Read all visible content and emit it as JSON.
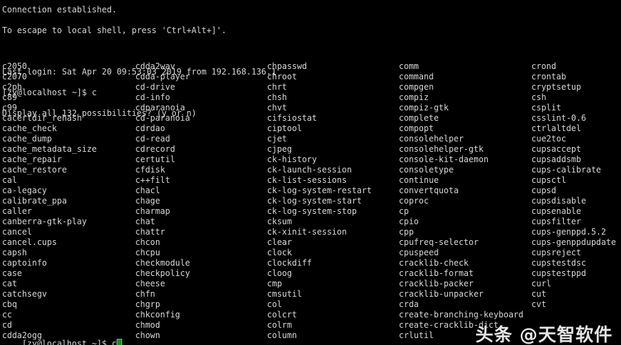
{
  "terminal": {
    "background_color": "#000000",
    "text_color": "#d7d7d7",
    "cursor_color": "#39d353",
    "header_lines": [
      "Connection established.",
      "To escape to local shell, press 'Ctrl+Alt+]'.",
      "",
      "Last login: Sat Apr 20 09:53:03 2019 from 192.168.136.1",
      "[zy@localhost ~]$ c",
      "Display all 132 possibilities? (y or n)"
    ],
    "prompt": {
      "text": "[zy@localhost ~]$ ",
      "typed": "c",
      "cursor": "block-cursor"
    },
    "completion": {
      "count": 132,
      "columns": [
        [
          "c2050",
          "c2070",
          "c2ph",
          "c89",
          "c99",
          "cacertdir_rehash",
          "cache_check",
          "cache_dump",
          "cache_metadata_size",
          "cache_repair",
          "cache_restore",
          "cal",
          "ca-legacy",
          "calibrate_ppa",
          "caller",
          "canberra-gtk-play",
          "cancel",
          "cancel.cups",
          "capsh",
          "captoinfo",
          "case",
          "cat",
          "catchsegv",
          "cbq",
          "cc",
          "cd",
          "cdda2ogg"
        ],
        [
          "cdda2wav",
          "cdda-player",
          "cd-drive",
          "cd-info",
          "cdparanoia",
          "cd-paranoia",
          "cdrdao",
          "cd-read",
          "cdrecord",
          "certutil",
          "cfdisk",
          "c++filt",
          "chacl",
          "chage",
          "charmap",
          "chat",
          "chattr",
          "chcon",
          "chcpu",
          "checkmodule",
          "checkpolicy",
          "cheese",
          "chfn",
          "chgrp",
          "chkconfig",
          "chmod",
          "chown"
        ],
        [
          "chpasswd",
          "chroot",
          "chrt",
          "chsh",
          "chvt",
          "cifsiostat",
          "ciptool",
          "cjet",
          "cjpeg",
          "ck-history",
          "ck-launch-session",
          "ck-list-sessions",
          "ck-log-system-restart",
          "ck-log-system-start",
          "ck-log-system-stop",
          "cksum",
          "ck-xinit-session",
          "clear",
          "clock",
          "clockdiff",
          "cloog",
          "cmp",
          "cmsutil",
          "col",
          "colcrt",
          "colrm",
          "column"
        ],
        [
          "comm",
          "command",
          "compgen",
          "compiz",
          "compiz-gtk",
          "complete",
          "compopt",
          "consolehelper",
          "consolehelper-gtk",
          "console-kit-daemon",
          "consoletype",
          "continue",
          "convertquota",
          "coproc",
          "cp",
          "cpio",
          "cpp",
          "cpufreq-selector",
          "cpuspeed",
          "cracklib-check",
          "cracklib-format",
          "cracklib-packer",
          "cracklib-unpacker",
          "crda",
          "create-branching-keyboard",
          "create-cracklib-dict",
          "crlutil"
        ],
        [
          "crond",
          "crontab",
          "cryptsetup",
          "csh",
          "csplit",
          "csslint-0.6",
          "ctrlaltdel",
          "cue2toc",
          "cupsaccept",
          "cupsaddsmb",
          "cups-calibrate",
          "cupsctl",
          "cupsd",
          "cupsdisable",
          "cupsenable",
          "cupsfilter",
          "cups-genppd.5.2",
          "cups-genppdupdate",
          "cupsreject",
          "cupstestdsc",
          "cupstestppd",
          "curl",
          "cut",
          "cvt"
        ]
      ]
    }
  },
  "watermark": {
    "text": "头条 @天智软件"
  }
}
